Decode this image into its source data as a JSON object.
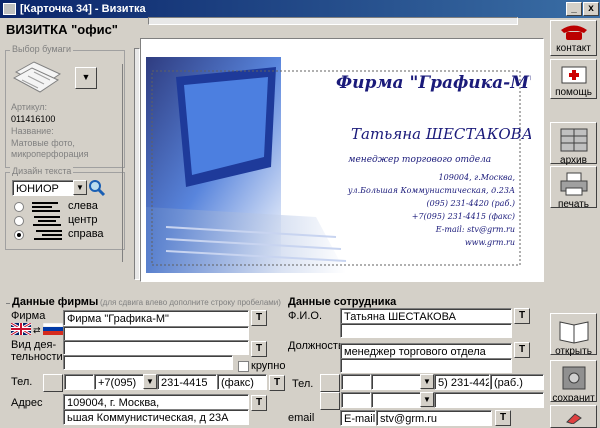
{
  "window": {
    "title": "[Карточка 34] - Визитка",
    "min": "_",
    "close": "x"
  },
  "header": {
    "title": "ВИЗИТКА \"офис\""
  },
  "paper": {
    "group_label": "Выбор бумаги",
    "article_label": "Артикул:",
    "article_value": "011416100",
    "name_label": "Название:",
    "name_value_1": "Матовые фото,",
    "name_value_2": "микроперфорация"
  },
  "design": {
    "group_label": "Дизайн текста",
    "font_value": "ЮНИОР",
    "align_left": "слева",
    "align_center": "центр",
    "align_right": "справа",
    "selected": "справа"
  },
  "card": {
    "company": "Фирма \"Графика-М\"",
    "person": "Татьяна ШЕСТАКОВА",
    "position": "менеджер торгового отдела",
    "addr1": "109004, г.Москва,",
    "addr2": "ул.Большая Коммунистическая, д.23А",
    "phone1": "(095) 231-4420 (раб.)",
    "phone2": "+7(095) 231-4415 (факс)",
    "email": "E-mail: stv@grm.ru",
    "web": "www.grm.ru"
  },
  "company_data": {
    "heading": "Данные фирмы",
    "hint": "(для сдвига влево дополните строку пробелами)",
    "firm_label": "Фирма",
    "firm_value": "Фирма \"Графика-М\"",
    "activity_label_1": "Вид дея-",
    "activity_label_2": "тельности",
    "bold_label": "крупно",
    "phone_label": "Тел.",
    "phone_code": "+7(095)",
    "phone_number": "231-4415",
    "phone_type": "(факс)",
    "address_label": "Адрес",
    "address_1": "109004, г. Москва,",
    "address_2": "ьшая Коммунистическая, д 23А"
  },
  "employee_data": {
    "heading": "Данные сотрудника",
    "name_label": "Ф.И.О.",
    "name_value": "Татьяна ШЕСТАКОВА",
    "position_label": "Должность",
    "position_value": "менеджер торгового отдела",
    "phone_label": "Тел.",
    "phone_number": "5) 231-4420",
    "phone_type": "(раб.)",
    "email_label": "email",
    "email_prefix": "E-mail:",
    "email_value": "stv@grm.ru"
  },
  "right_toolbar": {
    "contact": "контакт",
    "help": "помощь",
    "archive": "архив",
    "print": "печать",
    "open": "открыть",
    "save": "сохранит"
  },
  "t_label": "T",
  "colors": {
    "title_bar": "#0a246a",
    "card_blue": "#1a1a7a",
    "face": "#d4d0c8"
  }
}
